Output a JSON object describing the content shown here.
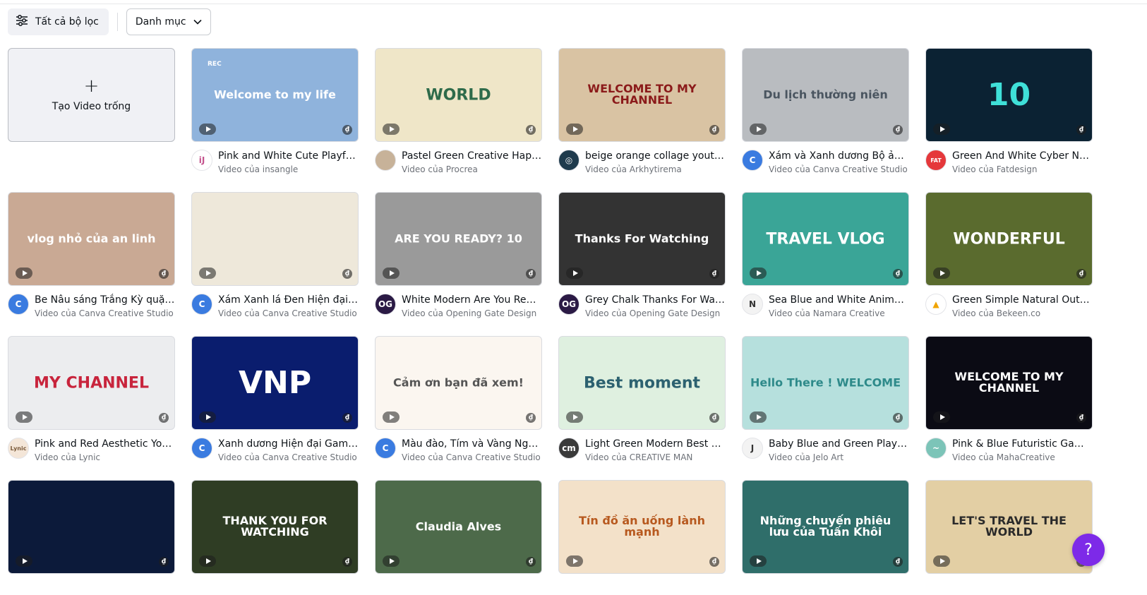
{
  "toolbar": {
    "all_filters_label": "Tất cả bộ lọc",
    "category_label": "Danh mục"
  },
  "create_card": {
    "label": "Tạo Video trống"
  },
  "help_label": "?",
  "templates": [
    {
      "title": "Pink and White Cute Playful ...",
      "author": "Video của insangle",
      "thumb_text": "Welcome to my life",
      "rec": "REC",
      "bg": "#8fb3dc",
      "text_color": "#ffffff",
      "avatar_text": "iJ",
      "avatar_bg": "#ffffff",
      "avatar_color": "#c4548e"
    },
    {
      "title": "Pastel Green Creative Happy...",
      "author": "Video của Procrea",
      "thumb_text": "WORLD",
      "bg": "#efe6c8",
      "text_color": "#2e6b4a",
      "avatar_text": "",
      "avatar_bg": "#c7b299",
      "avatar_color": "#ffffff"
    },
    {
      "title": "beige orange collage youtu...",
      "author": "Video của Arkhytirema",
      "thumb_text": "WELCOME TO MY CHANNEL",
      "bg": "#d9c3a3",
      "text_color": "#8b1a1a",
      "avatar_text": "◎",
      "avatar_bg": "#1f3b4d",
      "avatar_color": "#ffffff"
    },
    {
      "title": "Xám và Xanh dương Bộ ảnh ...",
      "author": "Video của Canva Creative Studio",
      "thumb_text": "Du lịch thường niên",
      "bg": "#b9bcc0",
      "text_color": "#4a5560",
      "avatar_text": "C",
      "avatar_bg": "#3a7be0",
      "avatar_color": "#ffffff"
    },
    {
      "title": "Green And White Cyber Neo...",
      "author": "Video của Fatdesign",
      "thumb_text": "10",
      "bg": "#0b2233",
      "text_color": "#3fe0d8",
      "avatar_text": "FAT",
      "avatar_bg": "#e5383b",
      "avatar_color": "#ffffff"
    },
    {
      "title": "Be Nâu sáng Trắng Kỳ quặc ...",
      "author": "Video của Canva Creative Studio",
      "thumb_text": "vlog nhỏ của an linh",
      "bg": "#c9a994",
      "text_color": "#ffffff",
      "avatar_text": "C",
      "avatar_bg": "#3a7be0",
      "avatar_color": "#ffffff"
    },
    {
      "title": "Xám Xanh lá Đen Hiện đại N...",
      "author": "Video của Canva Creative Studio",
      "thumb_text": "",
      "bg": "#eee8da",
      "text_color": "#3d9a4f",
      "avatar_text": "C",
      "avatar_bg": "#3a7be0",
      "avatar_color": "#ffffff"
    },
    {
      "title": "White Modern Are You Read...",
      "author": "Video của Opening Gate Design",
      "thumb_text": "ARE YOU READY? 10",
      "bg": "#9a9a9a",
      "text_color": "#ffffff",
      "avatar_text": "OG",
      "avatar_bg": "#2b1a45",
      "avatar_color": "#ffffff"
    },
    {
      "title": "Grey Chalk Thanks For Watc...",
      "author": "Video của Opening Gate Design",
      "thumb_text": "Thanks For Watching",
      "bg": "#333333",
      "text_color": "#ffffff",
      "avatar_text": "OG",
      "avatar_bg": "#2b1a45",
      "avatar_color": "#ffffff"
    },
    {
      "title": "Sea Blue and White Animate...",
      "author": "Video của Namara Creative",
      "thumb_text": "TRAVEL VLOG",
      "bg": "#3aa597",
      "text_color": "#ffffff",
      "avatar_text": "N",
      "avatar_bg": "#f3f3f3",
      "avatar_color": "#333333"
    },
    {
      "title": "Green Simple Natural Outdo...",
      "author": "Video của Bekeen.co",
      "thumb_text": "WONDERFUL",
      "bg": "#5a6b2e",
      "text_color": "#ffffff",
      "avatar_text": "▲",
      "avatar_bg": "#ffffff",
      "avatar_color": "#f0a400"
    },
    {
      "title": "Pink and Red Aesthetic YouT...",
      "author": "Video của Lynic",
      "thumb_text": "MY CHANNEL",
      "bg": "#ecedef",
      "text_color": "#c8243c",
      "avatar_text": "Lynic",
      "avatar_bg": "#f4e6d8",
      "avatar_color": "#7a5a3a"
    },
    {
      "title": "Xanh dương Hiện đại Game ...",
      "author": "Video của Canva Creative Studio",
      "thumb_text": "VNP",
      "bg": "#0a1d6e",
      "text_color": "#ffffff",
      "avatar_text": "C",
      "avatar_bg": "#3a7be0",
      "avatar_color": "#ffffff"
    },
    {
      "title": "Màu đào, Tím và Vàng Nghệ...",
      "author": "Video của Canva Creative Studio",
      "thumb_text": "Cảm ơn bạn đã xem!",
      "bg": "#fbf6f0",
      "text_color": "#555555",
      "avatar_text": "C",
      "avatar_bg": "#3a7be0",
      "avatar_color": "#ffffff"
    },
    {
      "title": "Light Green Modern Best M...",
      "author": "Video của CREATIVE MAN",
      "thumb_text": "Best moment",
      "bg": "#dff0e0",
      "text_color": "#2c6170",
      "avatar_text": "cm",
      "avatar_bg": "#3a3a3a",
      "avatar_color": "#ffffff"
    },
    {
      "title": "Baby Blue and Green Playful...",
      "author": "Video của Jelo Art",
      "thumb_text": "Hello There ! WELCOME",
      "bg": "#b6e0dd",
      "text_color": "#2e8a8a",
      "avatar_text": "J",
      "avatar_bg": "#f3f3f3",
      "avatar_color": "#333333"
    },
    {
      "title": "Pink & Blue Futuristic Gami...",
      "author": "Video của MahaCreative",
      "thumb_text": "WELCOME TO MY CHANNEL",
      "bg": "#0b0b14",
      "text_color": "#ffffff",
      "avatar_text": "~",
      "avatar_bg": "#7cc4b8",
      "avatar_color": "#ffffff"
    },
    {
      "title": "",
      "author": "",
      "thumb_text": "",
      "bg": "#0c1a3a",
      "text_color": "#7fd0ff",
      "avatar_text": "",
      "avatar_bg": "#ffffff",
      "avatar_color": "#ffffff"
    },
    {
      "title": "",
      "author": "",
      "thumb_text": "THANK YOU FOR WATCHING",
      "bg": "#2f3d24",
      "text_color": "#ffffff",
      "avatar_text": "",
      "avatar_bg": "#ffffff",
      "avatar_color": "#ffffff"
    },
    {
      "title": "",
      "author": "",
      "thumb_text": "Claudia Alves",
      "bg": "#4d6a4a",
      "text_color": "#ffffff",
      "avatar_text": "",
      "avatar_bg": "#ffffff",
      "avatar_color": "#ffffff"
    },
    {
      "title": "",
      "author": "",
      "thumb_text": "Tín đồ ăn uống lành mạnh",
      "bg": "#f3e1c9",
      "text_color": "#b7591f",
      "avatar_text": "",
      "avatar_bg": "#ffffff",
      "avatar_color": "#ffffff"
    },
    {
      "title": "",
      "author": "",
      "thumb_text": "Những chuyến phiêu lưu của Tuấn Khôi",
      "bg": "#2f6e6a",
      "text_color": "#ffffff",
      "avatar_text": "",
      "avatar_bg": "#ffffff",
      "avatar_color": "#ffffff"
    },
    {
      "title": "",
      "author": "",
      "thumb_text": "LET'S TRAVEL THE WORLD",
      "bg": "#e3cfa4",
      "text_color": "#2a2a2a",
      "avatar_text": "",
      "avatar_bg": "#ffffff",
      "avatar_color": "#ffffff"
    }
  ]
}
